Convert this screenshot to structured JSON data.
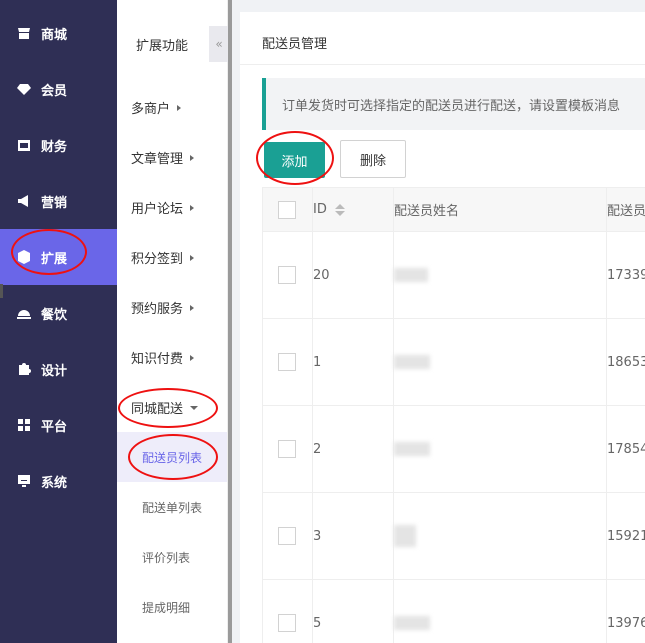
{
  "nav": {
    "items": [
      {
        "label": "商城",
        "icon": "shop-icon"
      },
      {
        "label": "会员",
        "icon": "diamond-icon"
      },
      {
        "label": "财务",
        "icon": "wallet-icon"
      },
      {
        "label": "营销",
        "icon": "megaphone-icon"
      },
      {
        "label": "扩展",
        "icon": "cube-icon"
      },
      {
        "label": "餐饮",
        "icon": "dish-icon"
      },
      {
        "label": "设计",
        "icon": "puzzle-icon"
      },
      {
        "label": "平台",
        "icon": "grid-icon"
      },
      {
        "label": "系统",
        "icon": "monitor-icon"
      }
    ],
    "active_color": "#6a66e8",
    "bg_color": "#2f2f55"
  },
  "subnav": {
    "title": "扩展功能",
    "collapse_glyph": "«",
    "groups": [
      {
        "label": "多商户"
      },
      {
        "label": "文章管理"
      },
      {
        "label": "用户论坛"
      },
      {
        "label": "积分签到"
      },
      {
        "label": "预约服务"
      },
      {
        "label": "知识付费"
      },
      {
        "label": "同城配送"
      }
    ],
    "children": [
      {
        "label": "配送员列表"
      },
      {
        "label": "配送单列表"
      },
      {
        "label": "评价列表"
      },
      {
        "label": "提成明细"
      }
    ]
  },
  "main": {
    "title": "配送员管理",
    "notice": "订单发货时可选择指定的配送员进行配送，请设置模板消息",
    "add_label": "添加",
    "delete_label": "删除",
    "table": {
      "headers": [
        "ID",
        "配送员姓名",
        "配送员"
      ],
      "rows": [
        {
          "id": "20",
          "phone": "17339"
        },
        {
          "id": "1",
          "phone": "18653"
        },
        {
          "id": "2",
          "phone": "17854"
        },
        {
          "id": "3",
          "phone": "15921"
        },
        {
          "id": "5",
          "phone": "13976"
        }
      ]
    },
    "accent_color": "#1aa094"
  }
}
